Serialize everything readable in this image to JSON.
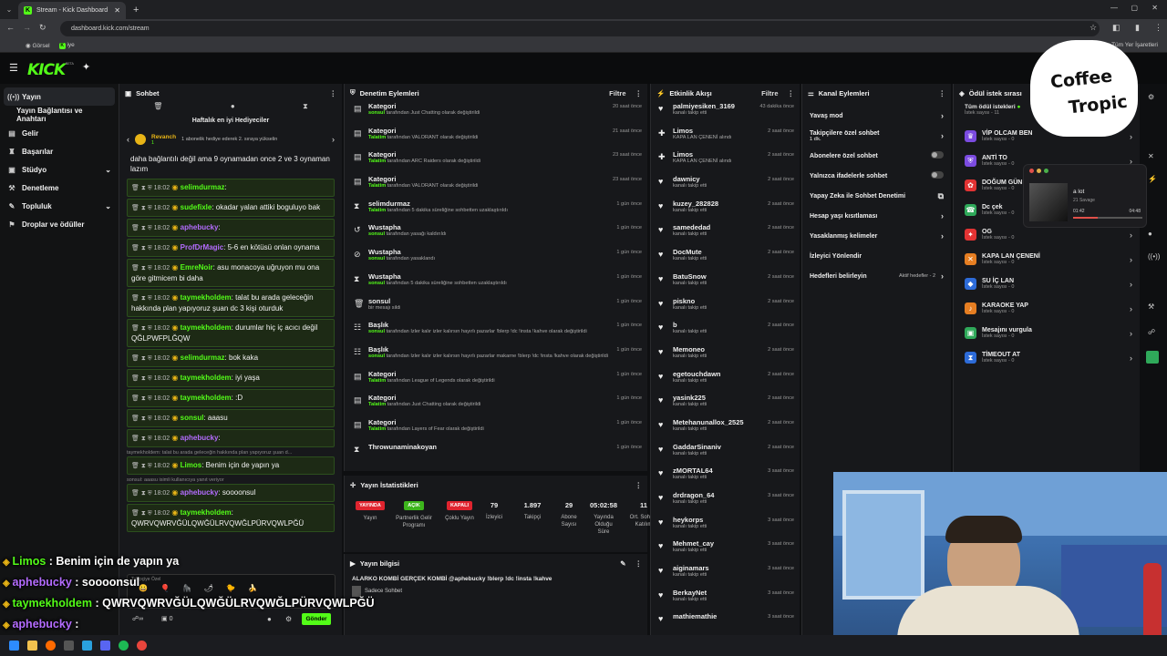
{
  "browser": {
    "tab_title": "Stream - Kick Dashboard",
    "url": "dashboard.kick.com/stream",
    "bookmarks": [
      "Görsel",
      "iye"
    ],
    "bookmarks_right": "Tüm Yer İşaretleri"
  },
  "app": {
    "logo": "KICK",
    "logo_beta": "BETA"
  },
  "sidebar": {
    "items": [
      {
        "label": "Yayın",
        "icon": "broadcast-icon",
        "active": true
      },
      {
        "label": "Yayın Bağlantısı ve Anahtarı"
      },
      {
        "label": "Gelir",
        "icon": "money-icon"
      },
      {
        "label": "Başarılar",
        "icon": "trophy-icon"
      },
      {
        "label": "Stüdyo",
        "icon": "studio-icon",
        "chevron": true
      },
      {
        "label": "Denetleme",
        "icon": "wrench-icon"
      },
      {
        "label": "Topluluk",
        "icon": "community-icon",
        "chevron": true
      },
      {
        "label": "Droplar ve ödüller",
        "icon": "gift-icon"
      }
    ]
  },
  "chat": {
    "title": "Sohbet",
    "gifters_title": "Haftalık en iyi Hediyeciler",
    "gifter_name": "Revanch",
    "gifter_count": "1",
    "gifter_note": "1 abonelik hediye ederek 2. sıraya yükselin",
    "messages": [
      {
        "text": "daha bağlantılı değil ama 9 oynamadan once 2 ve 3 oynaman lazım",
        "plain": true
      },
      {
        "time": "18:02",
        "user": "selimdurmaz",
        "color": "#53fc18",
        "text": ""
      },
      {
        "time": "18:02",
        "user": "sudefixle",
        "color": "#53fc18",
        "text": "okadar yalan attiki boguluyo bak"
      },
      {
        "time": "18:02",
        "user": "aphebucky",
        "color": "#b46cff",
        "text": ""
      },
      {
        "time": "18:02",
        "user": "ProfDrMagic",
        "color": "#b46cff",
        "text": "5-6 en kötüsü onlan oynama"
      },
      {
        "time": "18:02",
        "user": "EmreNoir",
        "color": "#53fc18",
        "text": "asu monacoya uğruyon mu ona göre gitmicem bi daha"
      },
      {
        "time": "18:02",
        "user": "taymekholdem",
        "color": "#53fc18",
        "text": "talat bu arada geleceğin hakkında plan yapıyoruz şuan dc 3 kişi oturduk"
      },
      {
        "time": "18:02",
        "user": "taymekholdem",
        "color": "#53fc18",
        "text": "durumlar hiç iç acıcı değil QĞLPWFPLĞQW"
      },
      {
        "time": "18:02",
        "user": "selimdurmaz",
        "color": "#53fc18",
        "text": "bok kaka"
      },
      {
        "time": "18:02",
        "user": "taymekholdem",
        "color": "#53fc18",
        "text": "iyi yaşa"
      },
      {
        "time": "18:02",
        "user": "taymekholdem",
        "color": "#53fc18",
        "text": ":D"
      },
      {
        "time": "18:02",
        "user": "sonsul",
        "color": "#53fc18",
        "text": "aaasu"
      },
      {
        "time": "18:02",
        "user": "aphebucky",
        "color": "#b46cff",
        "text": ""
      },
      {
        "reply": "taymekholdem: talat bu arada geleceğin hakkında plan yapıyoruz şuan d...",
        "time": "18:02",
        "user": "Limos",
        "color": "#53fc18",
        "text": "Benim için de yapın ya"
      },
      {
        "reply": "sonsul: aaasu isimli kullanıcıya yanıt veriyor",
        "time": "18:02",
        "user": "aphebucky",
        "color": "#b46cff",
        "text": "soooonsul"
      },
      {
        "time": "18:02",
        "user": "taymekholdem",
        "color": "#53fc18",
        "text": "QWRVQWRVĞÜLQWĞÜLRVQWĞLPÜRVQWLPĞÜ"
      },
      {
        "time": "18:02",
        "user": "aphebucky",
        "color": "#b46cff",
        "text": ""
      }
    ],
    "input_hint": "Takipçiye Özel",
    "send_label": "Gönder",
    "bottom_count": "0"
  },
  "modlog": {
    "title": "Denetim Eylemleri",
    "filter": "Filtre",
    "rows": [
      {
        "icon": "list-icon",
        "title": "Kategori",
        "actor": "sonsul",
        "desc": "tarafından Just Chatting olarak değiştirildi",
        "time": "20 saat önce"
      },
      {
        "icon": "list-icon",
        "title": "Kategori",
        "actor": "Talatim",
        "desc": "tarafından VALORANT olarak değiştirildi",
        "time": "21 saat önce"
      },
      {
        "icon": "list-icon",
        "title": "Kategori",
        "actor": "Talatim",
        "desc": "tarafından ARC Raiders olarak değiştirildi",
        "time": "23 saat önce"
      },
      {
        "icon": "list-icon",
        "title": "Kategori",
        "actor": "Talatim",
        "desc": "tarafından VALORANT olarak değiştirildi",
        "time": "23 saat önce"
      },
      {
        "icon": "hourglass-icon",
        "title": "selimdurmaz",
        "actor": "Talatim",
        "desc": "tarafından 5 dakika süreliğine sohbetten uzaklaştırıldı",
        "time": "1 gün önce"
      },
      {
        "icon": "undo-icon",
        "title": "Wustapha",
        "actor": "sonsul",
        "desc": "tarafından yasağı kaldırıldı",
        "time": "1 gün önce"
      },
      {
        "icon": "ban-icon",
        "title": "Wustapha",
        "actor": "sonsul",
        "desc": "tarafından yasaklandı",
        "time": "1 gün önce"
      },
      {
        "icon": "hourglass-icon",
        "title": "Wustapha",
        "actor": "sonsul",
        "desc": "tarafından 5 dakika süreliğine sohbetten uzaklaştırıldı",
        "time": "1 gün önce"
      },
      {
        "icon": "trash-icon",
        "title": "sonsul",
        "actor": "",
        "desc": "bir mesajı sildi",
        "time": "1 gün önce"
      },
      {
        "icon": "title-icon",
        "title": "Başlık",
        "actor": "sonsul",
        "desc": "tarafından İzler kalır izler kalırsın hayırlı pazarlar !blerp !dc !insta !kahve olarak değiştirildi",
        "time": "1 gün önce"
      },
      {
        "icon": "title-icon",
        "title": "Başlık",
        "actor": "sonsul",
        "desc": "tarafından İzler kalır izler kalırsın hayırlı pazarlar makarne !blerp !dc !insta !kahve olarak değiştirildi",
        "time": "1 gün önce"
      },
      {
        "icon": "list-icon",
        "title": "Kategori",
        "actor": "Talatim",
        "desc": "tarafından League of Legends olarak değiştirildi",
        "time": "1 gün önce"
      },
      {
        "icon": "list-icon",
        "title": "Kategori",
        "actor": "Talatim",
        "desc": "tarafından Just Chatting olarak değiştirildi",
        "time": "1 gün önce"
      },
      {
        "icon": "list-icon",
        "title": "Kategori",
        "actor": "Talatim",
        "desc": "tarafından Layers of Fear olarak değiştirildi",
        "time": "1 gün önce"
      },
      {
        "icon": "hourglass-icon",
        "title": "Throwunaminakoyan",
        "actor": "",
        "desc": "",
        "time": "1 gün önce"
      }
    ]
  },
  "stats": {
    "title": "Yayın İstatistikleri",
    "items": [
      {
        "badge": "YAYINDA",
        "badge_color": "#e0242f",
        "label": "Yayın"
      },
      {
        "badge": "AÇIK",
        "badge_color": "#3db51c",
        "label": "Partnerlik Gelir Programı"
      },
      {
        "badge": "KAPALI",
        "badge_color": "#e0242f",
        "label": "Çoklu Yayın"
      },
      {
        "value": "79",
        "label": "İzleyici"
      },
      {
        "value": "1.897",
        "label": "Takipçi"
      },
      {
        "value": "29",
        "label": "Abone Sayısı"
      },
      {
        "value": "05:02:58",
        "label": "Yayında Olduğu Süre"
      },
      {
        "value": "11",
        "label": "Ort. Sohbet Katılım"
      }
    ]
  },
  "streaminfo": {
    "title": "Yayın bilgisi",
    "stream_title": "ALARKO KOMBİ GERÇEK KOMBİ @aphebucky !blerp !dc !insta !kahve",
    "category": "Sadece Sohbet"
  },
  "activity": {
    "title": "Etkinlik Akışı",
    "filter": "Filtre",
    "rows": [
      {
        "icon": "heart-icon",
        "name": "palmiyesiken_3169",
        "sub": "kanalı takip etti",
        "time": "43 dakika önce"
      },
      {
        "icon": "gift-icon",
        "name": "Limos",
        "sub": "KAPA LAN ÇENENİ alındı",
        "time": "2 saat önce",
        "green": true
      },
      {
        "icon": "gift-icon",
        "name": "Limos",
        "sub": "KAPA LAN ÇENENİ alındı",
        "time": "2 saat önce",
        "green": true
      },
      {
        "icon": "heart-icon",
        "name": "dawnicy",
        "sub": "kanalı takip etti",
        "time": "2 saat önce"
      },
      {
        "icon": "heart-icon",
        "name": "kuzey_282828",
        "sub": "kanalı takip etti",
        "time": "2 saat önce"
      },
      {
        "icon": "heart-icon",
        "name": "samededad",
        "sub": "kanalı takip etti",
        "time": "2 saat önce"
      },
      {
        "icon": "heart-icon",
        "name": "DocMute",
        "sub": "kanalı takip etti",
        "time": "2 saat önce"
      },
      {
        "icon": "heart-icon",
        "name": "BatuSnow",
        "sub": "kanalı takip etti",
        "time": "2 saat önce"
      },
      {
        "icon": "heart-icon",
        "name": "piskno",
        "sub": "kanalı takip etti",
        "time": "2 saat önce"
      },
      {
        "icon": "heart-icon",
        "name": "b",
        "sub": "kanalı takip etti",
        "time": "2 saat önce"
      },
      {
        "icon": "heart-icon",
        "name": "Memoneo",
        "sub": "kanalı takip etti",
        "time": "2 saat önce"
      },
      {
        "icon": "heart-icon",
        "name": "egetouchdawn",
        "sub": "kanalı takip etti",
        "time": "2 saat önce"
      },
      {
        "icon": "heart-icon",
        "name": "yasink225",
        "sub": "kanalı takip etti",
        "time": "2 saat önce"
      },
      {
        "icon": "heart-icon",
        "name": "Metehanunallox_2525",
        "sub": "kanalı takip etti",
        "time": "2 saat önce"
      },
      {
        "icon": "heart-icon",
        "name": "GaddarSinaniv",
        "sub": "kanalı takip etti",
        "time": "2 saat önce"
      },
      {
        "icon": "heart-icon",
        "name": "zMORTAL64",
        "sub": "kanalı takip etti",
        "time": "3 saat önce"
      },
      {
        "icon": "heart-icon",
        "name": "drdragon_64",
        "sub": "kanalı takip etti",
        "time": "3 saat önce"
      },
      {
        "icon": "heart-icon",
        "name": "heykorps",
        "sub": "kanalı takip etti",
        "time": "3 saat önce"
      },
      {
        "icon": "heart-icon",
        "name": "Mehmet_cay",
        "sub": "kanalı takip etti",
        "time": "3 saat önce"
      },
      {
        "icon": "heart-icon",
        "name": "aiginamars",
        "sub": "kanalı takip etti",
        "time": "3 saat önce"
      },
      {
        "icon": "heart-icon",
        "name": "BerkayNet",
        "sub": "kanalı takip etti",
        "time": "3 saat önce"
      },
      {
        "icon": "heart-icon",
        "name": "mathiemathie",
        "sub": "",
        "time": "3 saat önce"
      }
    ]
  },
  "channel": {
    "title": "Kanal Eylemleri",
    "rows": [
      {
        "label": "Yavaş mod",
        "ctl": "chevron"
      },
      {
        "label": "Takipçilere özel sohbet",
        "sub": "1 dk.",
        "ctl": "chevron"
      },
      {
        "label": "Abonelere özel sohbet",
        "ctl": "toggle"
      },
      {
        "label": "Yalnızca ifadelerle sohbet",
        "ctl": "toggle"
      },
      {
        "label": "Yapay Zeka ile Sohbet Denetimi",
        "ctl": "external"
      },
      {
        "label": "Hesap yaşı kısıtlaması",
        "ctl": "chevron"
      },
      {
        "label": "Yasaklanmış kelimeler",
        "ctl": "chevron"
      },
      {
        "label": "İzleyici Yönlendir",
        "ctl": ""
      },
      {
        "label": "Hedefleri belirleyin",
        "extra": "Aktif hedefler - 2",
        "ctl": "chevron"
      }
    ]
  },
  "rewards": {
    "title": "Ödül istek sırası",
    "all_title": "Tüm ödül istekleri",
    "all_sub": "İstek sayısı - 11",
    "items": [
      {
        "name": "VİP OLCAM BEN",
        "sub": "İstek sayısı - 0",
        "color": "#7b4be0",
        "icon": "crown-icon"
      },
      {
        "name": "ANTİ TO",
        "sub": "İstek sayısı - 0",
        "color": "#7b4be0",
        "icon": "shield-icon"
      },
      {
        "name": "DOĞUM GÜN",
        "sub": "İstek sayısı - 0",
        "color": "#e23333",
        "icon": "cake-icon"
      },
      {
        "name": "Dc çek",
        "sub": "İstek sayısı - 0",
        "color": "#2fa95a",
        "icon": "phone-icon"
      },
      {
        "name": "OG",
        "sub": "İstek sayısı - 0",
        "color": "#e23333",
        "icon": "star-icon"
      },
      {
        "name": "KAPA LAN ÇENENİ",
        "sub": "İstek sayısı - 0",
        "color": "#e67e22",
        "icon": "mute-icon"
      },
      {
        "name": "SU İÇ LAN",
        "sub": "İstek sayısı - 0",
        "color": "#2d6bd8",
        "icon": "drop-icon"
      },
      {
        "name": "KARAOKE YAP",
        "sub": "İstek sayısı - 0",
        "color": "#e67e22",
        "icon": "mic-icon"
      },
      {
        "name": "Mesajını vurgula",
        "sub": "İstek sayısı - 0",
        "color": "#2fa95a",
        "icon": "highlight-icon"
      },
      {
        "name": "TİMEOUT AT",
        "sub": "İstek sayısı - 0",
        "color": "#2d6bd8",
        "icon": "timer-icon"
      }
    ]
  },
  "music": {
    "title": "a lot",
    "artist": "21 Savage",
    "elapsed": "01:42",
    "total": "04:48",
    "progress": 0.35
  },
  "overlay": {
    "brand_line1": "Coffee",
    "brand_line2": "Tropic",
    "lines": [
      {
        "user": "Limos",
        "text": "Benim için de yapın ya",
        "color": "#53fc18"
      },
      {
        "user": "aphebucky",
        "text": "soooonsul",
        "color": "#b46cff"
      },
      {
        "user": "taymekholdem",
        "text": "QWRVQWRVĞÜLQWĞÜLRVQWĞLPÜRVQWLPĞÜ",
        "color": "#53fc18"
      },
      {
        "user": "aphebucky",
        "text": "",
        "color": "#b46cff"
      }
    ]
  },
  "colors": {
    "accent": "#53fc18",
    "panel": "#17181b",
    "bg": "#0e0f11"
  }
}
